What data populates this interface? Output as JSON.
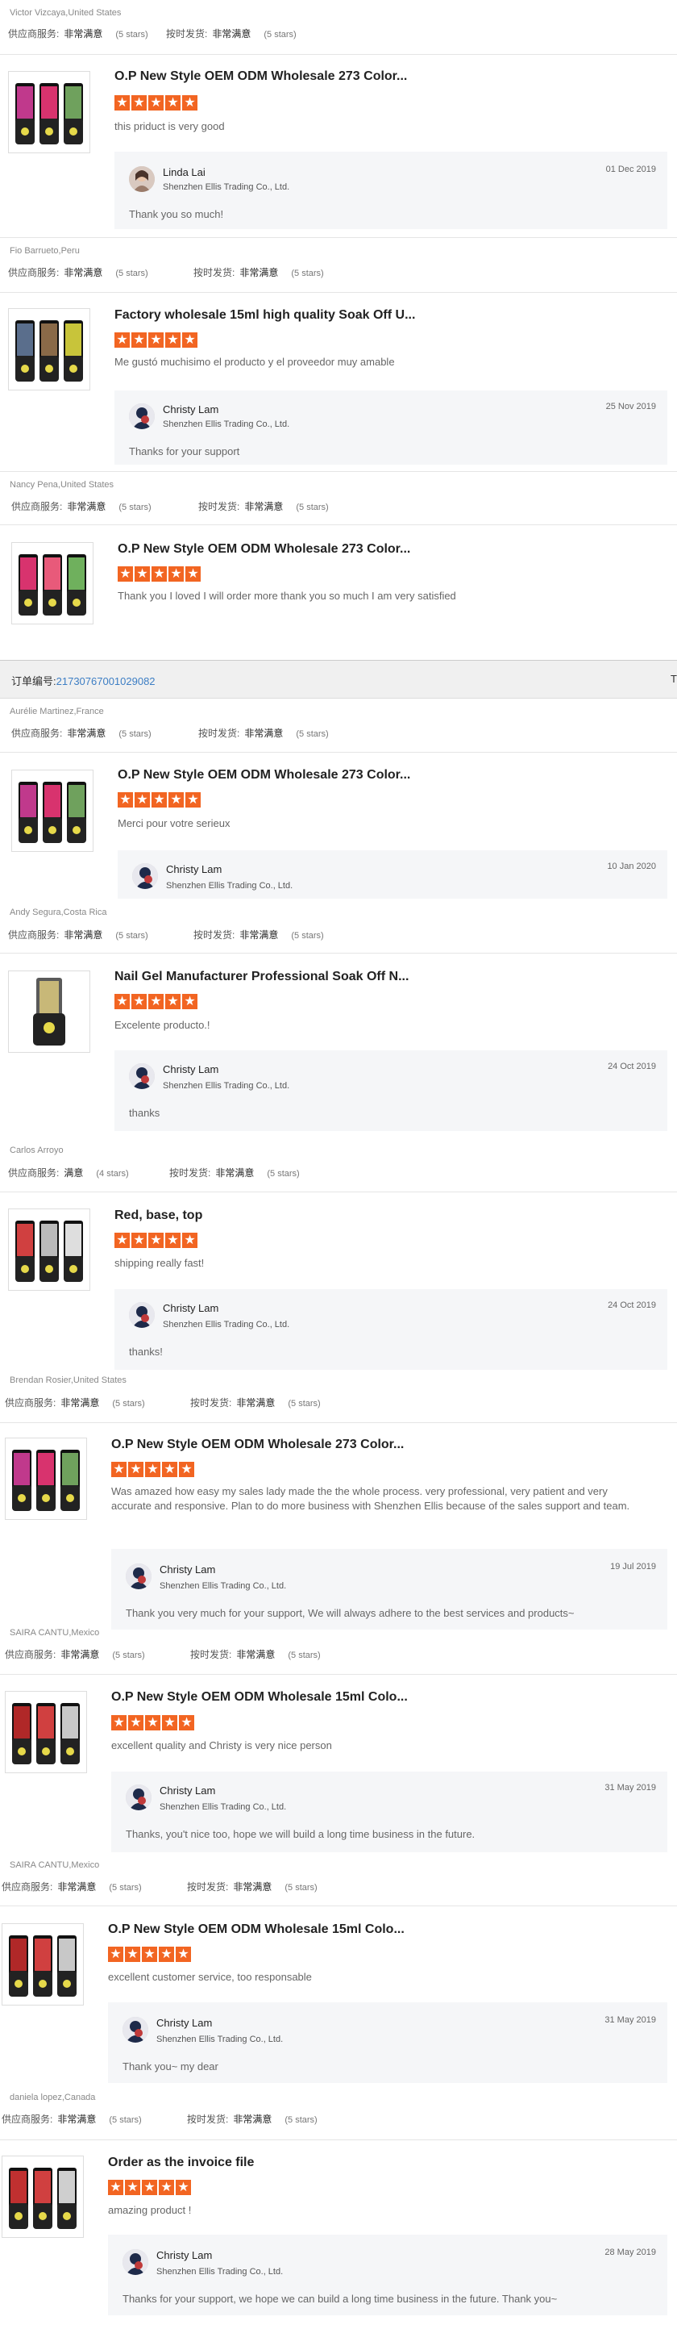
{
  "labels": {
    "supplier_service": "供应商服务:",
    "ship_on_time": "按时发货:",
    "very_satisfied": "非常满意",
    "satisfied": "满意",
    "five_stars": "(5 stars)",
    "four_stars": "(4 stars)"
  },
  "order": {
    "label": "订单编号:",
    "number": "21730767001029082",
    "more": "T"
  },
  "colors": {
    "star": "#f26522",
    "link": "#3d7ec4"
  },
  "reviews": [
    {
      "reviewer": "Victor Vizcaya,United States",
      "service_value": "非常满意",
      "service_stars": "(5 stars)",
      "ship_value": "非常满意",
      "ship_stars": "(5 stars)",
      "product_title": "O.P New Style OEM ODM Wholesale 273 Color...",
      "rating": 5,
      "comment": "this priduct is very good",
      "reply": {
        "name": "Linda Lai",
        "company": "Shenzhen Ellis Trading Co., Ltd.",
        "date": "01 Dec 2019",
        "text": "Thank you so much!"
      }
    },
    {
      "reviewer": "Fio Barrueto,Peru",
      "service_value": "非常满意",
      "service_stars": "(5 stars)",
      "ship_value": "非常满意",
      "ship_stars": "(5 stars)",
      "product_title": "Factory wholesale 15ml high quality Soak Off U...",
      "rating": 5,
      "comment": "Me gustó muchisimo el producto y el proveedor muy amable",
      "reply": {
        "name": "Christy Lam",
        "company": "Shenzhen Ellis Trading Co., Ltd.",
        "date": "25 Nov 2019",
        "text": "Thanks for your support"
      }
    },
    {
      "reviewer": "Nancy Pena,United States",
      "service_value": "非常满意",
      "service_stars": "(5 stars)",
      "ship_value": "非常满意",
      "ship_stars": "(5 stars)",
      "product_title": "O.P New Style OEM ODM Wholesale 273 Color...",
      "rating": 5,
      "comment": "Thank you I loved I will order more thank you so much I am very satisfied"
    },
    {
      "reviewer": "Aurélie Martinez,France",
      "service_value": "非常满意",
      "service_stars": "(5 stars)",
      "ship_value": "非常满意",
      "ship_stars": "(5 stars)",
      "product_title": "O.P New Style OEM ODM Wholesale 273 Color...",
      "rating": 5,
      "comment": "Merci pour votre serieux",
      "reply": {
        "name": "Christy Lam",
        "company": "Shenzhen Ellis Trading Co., Ltd.",
        "date": "10 Jan 2020",
        "text": ""
      }
    },
    {
      "reviewer": "Andy Segura,Costa Rica",
      "service_value": "非常满意",
      "service_stars": "(5 stars)",
      "ship_value": "非常满意",
      "ship_stars": "(5 stars)",
      "product_title": "Nail Gel Manufacturer Professional Soak Off N...",
      "rating": 5,
      "comment": "Excelente producto.!",
      "reply": {
        "name": "Christy Lam",
        "company": "Shenzhen Ellis Trading Co., Ltd.",
        "date": "24 Oct 2019",
        "text": "thanks"
      }
    },
    {
      "reviewer": "Carlos Arroyo",
      "service_value": "满意",
      "service_stars": "(4 stars)",
      "ship_value": "非常满意",
      "ship_stars": "(5 stars)",
      "product_title": "Red, base, top",
      "rating": 5,
      "comment": "shipping really fast!",
      "reply": {
        "name": "Christy Lam",
        "company": "Shenzhen Ellis Trading Co., Ltd.",
        "date": "24 Oct 2019",
        "text": "thanks!"
      }
    },
    {
      "reviewer": "Brendan Rosier,United States",
      "service_value": "非常满意",
      "service_stars": "(5 stars)",
      "ship_value": "非常满意",
      "ship_stars": "(5 stars)",
      "product_title": "O.P New Style OEM ODM Wholesale 273 Color...",
      "rating": 5,
      "comment": "Was amazed how easy my sales lady made the the whole process. very professional, very patient and very accurate and responsive. Plan to do more business with Shenzhen Ellis because of the sales support and team.",
      "reply": {
        "name": "Christy Lam",
        "company": "Shenzhen Ellis Trading Co., Ltd.",
        "date": "19 Jul 2019",
        "text": "Thank you very much for your support, We will always adhere to the best services and products~"
      }
    },
    {
      "reviewer": "SAIRA CANTU,Mexico",
      "service_value": "非常满意",
      "service_stars": "(5 stars)",
      "ship_value": "非常满意",
      "ship_stars": "(5 stars)",
      "product_title": "O.P New Style OEM ODM Wholesale 15ml Colo...",
      "rating": 5,
      "comment": "excellent quality and Christy is very nice person",
      "reply": {
        "name": "Christy Lam",
        "company": "Shenzhen Ellis Trading Co., Ltd.",
        "date": "31 May 2019",
        "text": "Thanks, you't nice too, hope we will build a long time business in the future."
      }
    },
    {
      "reviewer": "SAIRA CANTU,Mexico",
      "service_value": "非常满意",
      "service_stars": "(5 stars)",
      "ship_value": "非常满意",
      "ship_stars": "(5 stars)",
      "product_title": "O.P New Style OEM ODM Wholesale 15ml Colo...",
      "rating": 5,
      "comment": "excellent customer service, too responsable",
      "reply": {
        "name": "Christy Lam",
        "company": "Shenzhen Ellis Trading Co., Ltd.",
        "date": "31 May 2019",
        "text": "Thank you~ my dear"
      }
    },
    {
      "reviewer": "daniela lopez,Canada",
      "service_value": "非常满意",
      "service_stars": "(5 stars)",
      "ship_value": "非常满意",
      "ship_stars": "(5 stars)",
      "product_title": "Order as the invoice file",
      "rating": 5,
      "comment": "amazing product !",
      "reply": {
        "name": "Christy Lam",
        "company": "Shenzhen Ellis Trading Co., Ltd.",
        "date": "28 May 2019",
        "text": "Thanks for your support, we hope we can build a long time business in the future. Thank you~"
      }
    }
  ]
}
